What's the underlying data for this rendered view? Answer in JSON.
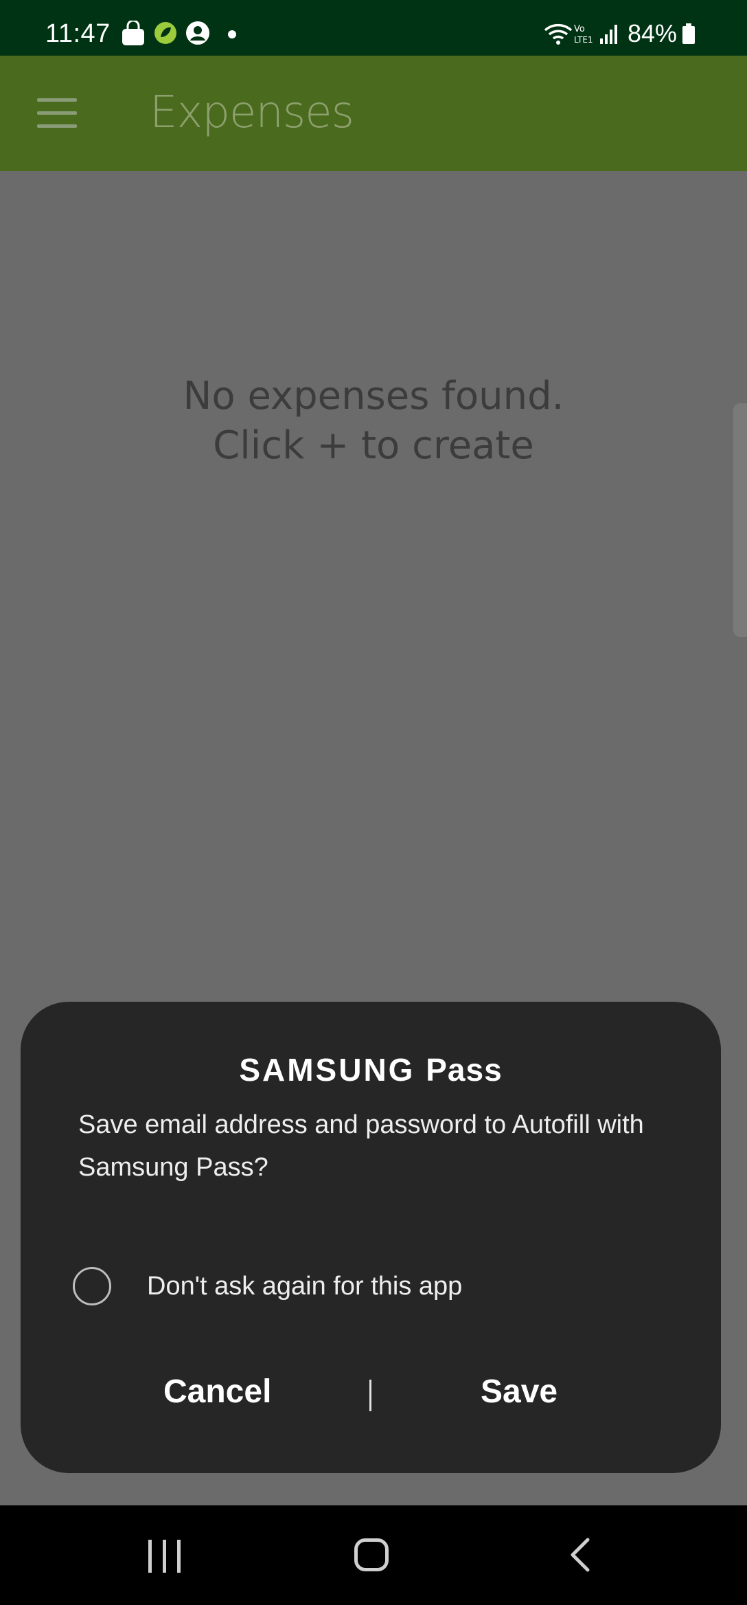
{
  "status_bar": {
    "time": "11:47",
    "battery": "84%",
    "icons": [
      "shopping-bag-icon",
      "leaf-app-icon",
      "account-icon",
      "dot-icon",
      "wifi-icon",
      "volte-icon",
      "signal-icon",
      "battery-icon"
    ]
  },
  "app_bar": {
    "title": "Expenses",
    "menu_icon": "hamburger-menu-icon",
    "color": "#4a6b1d"
  },
  "content": {
    "empty_line1": "No expenses found.",
    "empty_line2": "Click + to create"
  },
  "dialog": {
    "brand": "SAMSUNG",
    "brand_suffix": "Pass",
    "message": "Save email address and password to Autofill with Samsung Pass?",
    "checkbox_label": "Don't ask again for this app",
    "checkbox_checked": false,
    "cancel_label": "Cancel",
    "save_label": "Save"
  },
  "nav_bar": {
    "icons": [
      "recent-apps-icon",
      "home-icon",
      "back-icon"
    ]
  }
}
